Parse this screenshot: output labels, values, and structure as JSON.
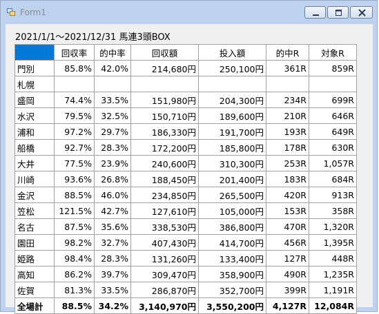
{
  "window": {
    "title": "Form1",
    "buttons": {
      "minimize": "minimize",
      "maximize": "maximize",
      "close": "close"
    }
  },
  "caption": "2021/1/1～2021/12/31 馬連3頭BOX",
  "table": {
    "headers": [
      "",
      "回収率",
      "的中率",
      "回収額",
      "投入額",
      "的中R",
      "対象R"
    ],
    "rows": [
      [
        "門別",
        "85.8%",
        "42.0%",
        "214,680円",
        "250,100円",
        "361R",
        "859R"
      ],
      [
        "札幌",
        "",
        "",
        "",
        "",
        "",
        ""
      ],
      [
        "盛岡",
        "74.4%",
        "33.5%",
        "151,980円",
        "204,300円",
        "234R",
        "699R"
      ],
      [
        "水沢",
        "79.5%",
        "32.5%",
        "150,710円",
        "189,600円",
        "210R",
        "646R"
      ],
      [
        "浦和",
        "97.2%",
        "29.7%",
        "186,330円",
        "191,700円",
        "193R",
        "649R"
      ],
      [
        "船橋",
        "92.7%",
        "28.3%",
        "172,200円",
        "185,800円",
        "178R",
        "630R"
      ],
      [
        "大井",
        "77.5%",
        "23.9%",
        "240,600円",
        "310,300円",
        "253R",
        "1,057R"
      ],
      [
        "川崎",
        "93.6%",
        "26.8%",
        "188,450円",
        "201,400円",
        "183R",
        "684R"
      ],
      [
        "金沢",
        "88.5%",
        "46.0%",
        "234,850円",
        "265,500円",
        "420R",
        "913R"
      ],
      [
        "笠松",
        "121.5%",
        "42.7%",
        "127,610円",
        "105,000円",
        "153R",
        "358R"
      ],
      [
        "名古",
        "87.5%",
        "35.6%",
        "338,530円",
        "386,800円",
        "470R",
        "1,320R"
      ],
      [
        "園田",
        "98.2%",
        "32.7%",
        "407,430円",
        "414,700円",
        "456R",
        "1,395R"
      ],
      [
        "姫路",
        "98.4%",
        "28.3%",
        "131,260円",
        "133,400円",
        "127R",
        "448R"
      ],
      [
        "高知",
        "86.2%",
        "39.7%",
        "309,470円",
        "358,900円",
        "490R",
        "1,235R"
      ],
      [
        "佐賀",
        "81.3%",
        "33.5%",
        "286,870円",
        "352,700円",
        "399R",
        "1,191R"
      ]
    ],
    "total": [
      "全場計",
      "88.5%",
      "34.2%",
      "3,140,970円",
      "3,550,200円",
      "4,127R",
      "12,084R"
    ]
  },
  "colors": {
    "selected_header": "#0078d7",
    "grid_line": "#a0a0a0",
    "client_bg": "#f0f0f0"
  }
}
